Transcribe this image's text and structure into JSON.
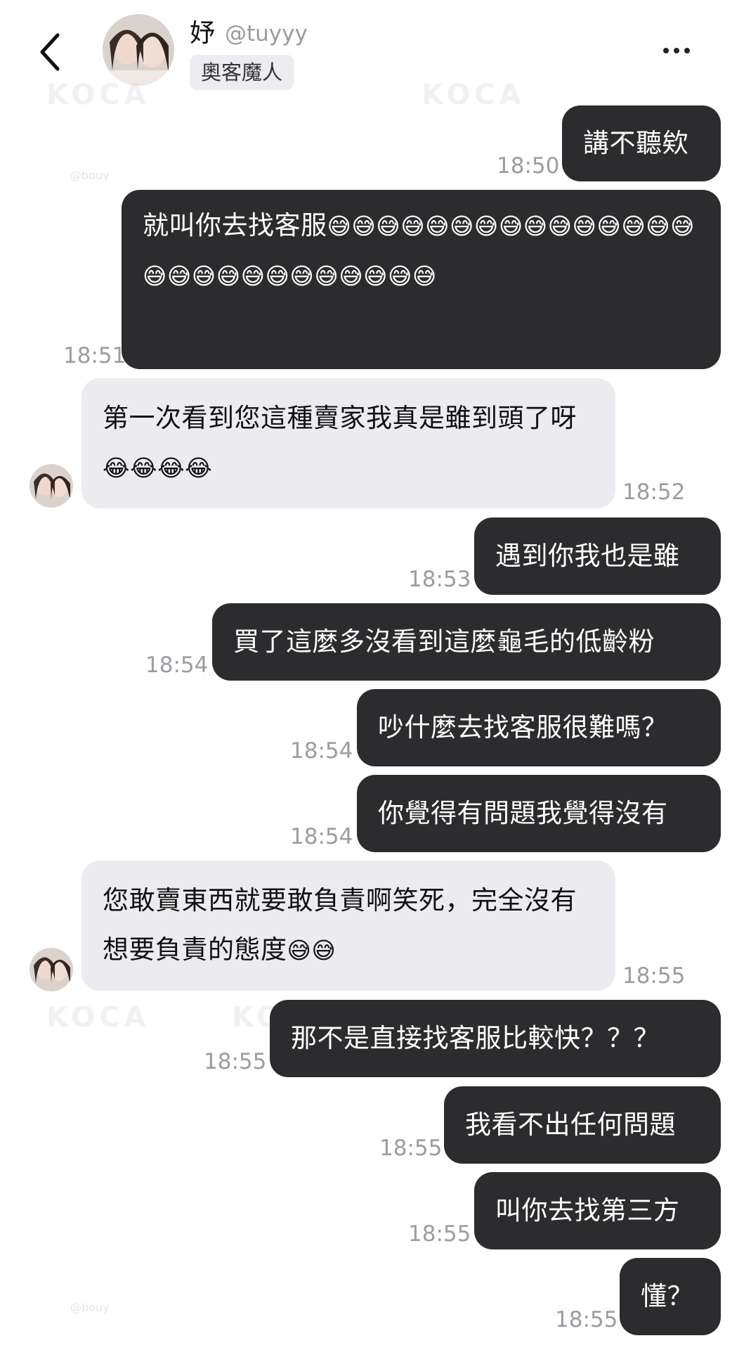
{
  "header": {
    "name": "妤",
    "handle": "@tuyyy",
    "badge": "奧客魔人"
  },
  "watermarks": {
    "logo": "KOCA",
    "handle": "@bouy"
  },
  "messages": [
    {
      "side": "out",
      "text": "講不聽欸",
      "time": "18:50"
    },
    {
      "side": "out",
      "text": "就叫你去找客服",
      "emoji": "😅😅😅😅😅😅😅😅😅😅😅😅😅😅😅😅😅😅😅😅😅😅😅😅😅😅😅",
      "time": "18:51"
    },
    {
      "side": "in",
      "text": "第一次看到您這種賣家我真是雖到頭了呀",
      "emoji": "😂😂😂😂",
      "time": "18:52"
    },
    {
      "side": "out",
      "text": "遇到你我也是雖",
      "time": "18:53"
    },
    {
      "side": "out",
      "text": "買了這麼多沒看到這麼龜毛的低齡粉",
      "time": "18:54"
    },
    {
      "side": "out",
      "text": "吵什麼去找客服很難嗎？",
      "time": "18:54"
    },
    {
      "side": "out",
      "text": "你覺得有問題我覺得沒有",
      "time": "18:54"
    },
    {
      "side": "in",
      "text": "您敢賣東西就要敢負責啊笑死，完全沒有想要負責的態度",
      "emoji": "😅😅",
      "time": "18:55"
    },
    {
      "side": "out",
      "text": "那不是直接找客服比較快？？？",
      "time": "18:55"
    },
    {
      "side": "out",
      "text": "我看不出任何問題",
      "time": "18:55"
    },
    {
      "side": "out",
      "text": "叫你去找第三方",
      "time": "18:55"
    },
    {
      "side": "out",
      "text": "懂？",
      "time": "18:55"
    }
  ]
}
